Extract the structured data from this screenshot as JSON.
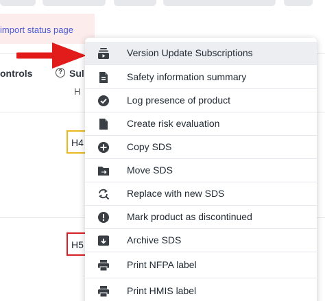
{
  "background": {
    "import_link": "import status page",
    "header": {
      "controls": "ontrols",
      "help_icon_glyph": "?",
      "sub_column": "Sul",
      "sub_letter": "H"
    },
    "hazard_codes": [
      {
        "text": "H4",
        "color": "#e8b81c"
      },
      {
        "text": "H5",
        "color": "#d81f26"
      }
    ]
  },
  "arrow_color": "#e21b1b",
  "context_menu": {
    "items": [
      {
        "label": "Version Update Subscriptions",
        "icon": "subscription-box-icon",
        "active": true
      },
      {
        "label": "Safety information summary",
        "icon": "document-info-icon"
      },
      {
        "label": "Log presence of product",
        "icon": "check-circle-icon"
      },
      {
        "label": "Create risk evaluation",
        "icon": "document-icon"
      },
      {
        "label": "Copy SDS",
        "icon": "plus-circle-icon"
      },
      {
        "label": "Move SDS",
        "icon": "folder-move-icon"
      },
      {
        "label": "Replace with new SDS",
        "icon": "replace-search-icon"
      },
      {
        "label": "Mark product as discontinued",
        "icon": "alert-circle-icon"
      },
      {
        "label": "Archive SDS",
        "icon": "archive-box-icon"
      },
      {
        "label": "Print NFPA label",
        "icon": "printer-icon"
      },
      {
        "label": "Print HMIS label",
        "icon": "printer-icon"
      }
    ]
  }
}
